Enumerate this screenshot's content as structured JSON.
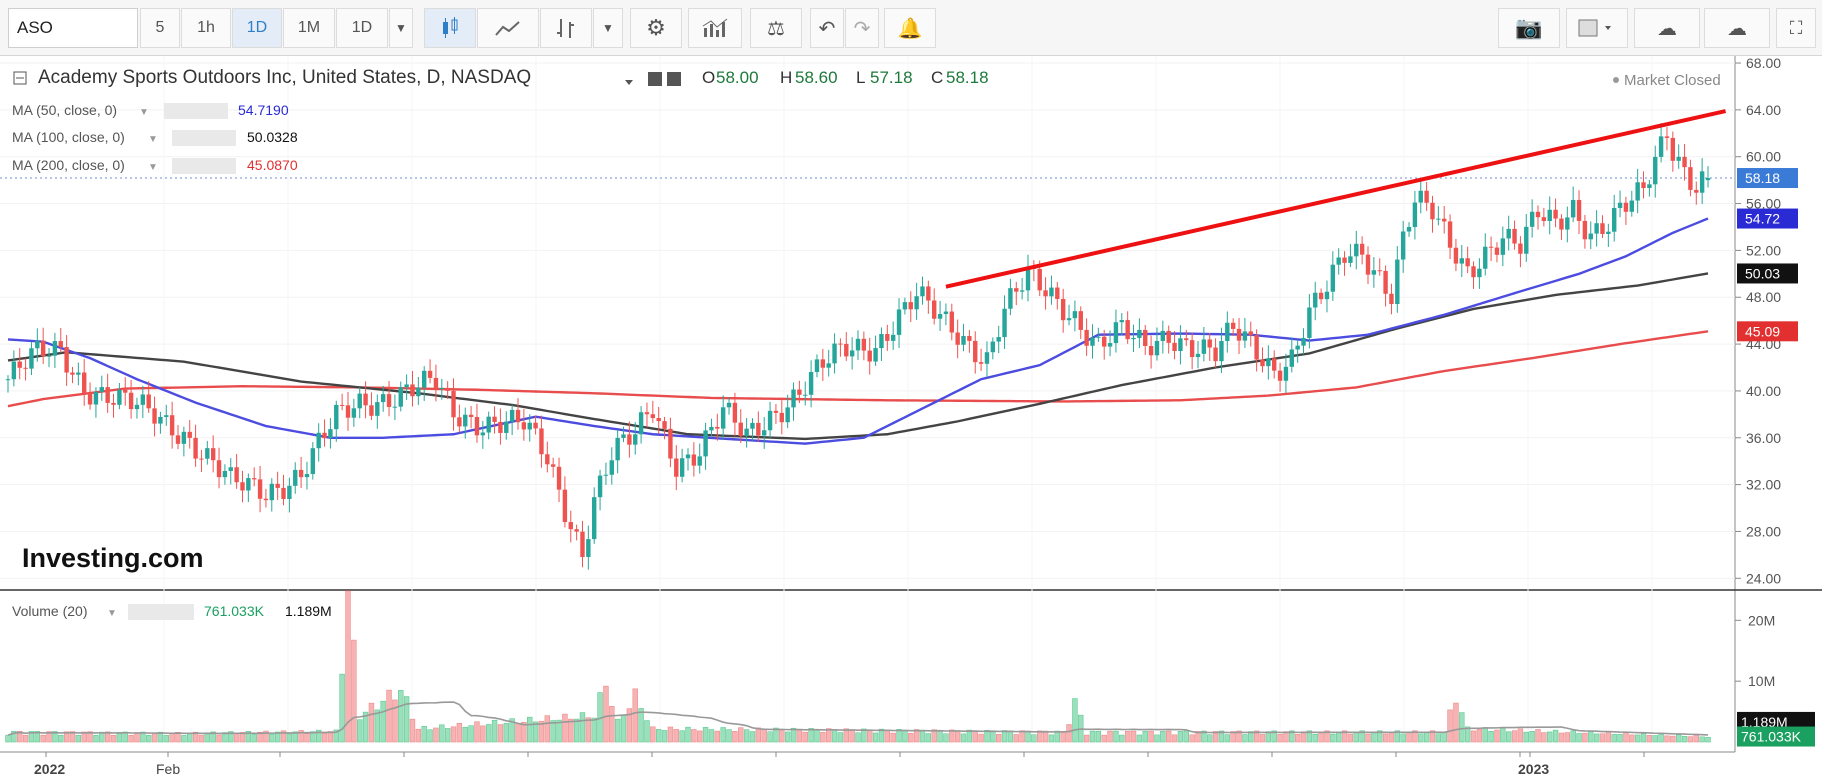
{
  "toolbar": {
    "symbol": "ASO",
    "intervals": [
      "5",
      "1h",
      "1D",
      "1M",
      "1D"
    ],
    "active_interval": "1D"
  },
  "header": {
    "title": "Academy Sports Outdoors Inc, United States, D, NASDAQ",
    "open_label": "O",
    "open": "58.00",
    "high_label": "H",
    "high": "58.60",
    "low_label": "L",
    "low": "57.18",
    "close_label": "C",
    "close": "58.18",
    "status": "Market Closed"
  },
  "indicators": [
    {
      "label": "MA (50, close, 0)",
      "value": "54.7190",
      "color": "#2b2bd6"
    },
    {
      "label": "MA (100, close, 0)",
      "value": "50.0328",
      "color": "#111111"
    },
    {
      "label": "MA (200, close, 0)",
      "value": "45.0870",
      "color": "#e23030"
    }
  ],
  "volume_pane": {
    "label": "Volume (20)",
    "value1": "761.033K",
    "value2": "1.189M"
  },
  "watermark": "Investing.com",
  "colors": {
    "up": "#26a69a",
    "down": "#ef5350",
    "ma50": "#4c4ce0",
    "ma100": "#444444",
    "ma200": "#e84c4c",
    "trend": "#ee1111"
  },
  "chart_data": {
    "type": "candlestick",
    "price_axis": {
      "ticks": [
        "68.00",
        "64.00",
        "60.00",
        "56.00",
        "52.00",
        "48.00",
        "44.00",
        "40.00",
        "36.00",
        "32.00",
        "28.00",
        "24.00"
      ],
      "range": [
        23,
        68.6
      ]
    },
    "volume_axis": {
      "ticks": [
        "20M",
        "10M"
      ],
      "range": [
        0,
        24
      ]
    },
    "x_axis": {
      "labels": [
        "2022",
        "Feb",
        "2023"
      ],
      "ticks": 15
    },
    "price_labels": [
      {
        "text": "58.18",
        "value": 58.18,
        "bg": "#3b7bd8"
      },
      {
        "text": "54.72",
        "value": 54.72,
        "bg": "#2b2bd6"
      },
      {
        "text": "50.03",
        "value": 50.03,
        "bg": "#111111"
      },
      {
        "text": "45.09",
        "value": 45.09,
        "bg": "#e23030"
      }
    ],
    "volume_labels": [
      {
        "text": "1.189M",
        "value": 1.189,
        "bg": "#111111"
      },
      {
        "text": "761.033K",
        "value": 0.761,
        "bg": "#1aa060"
      }
    ],
    "close_keypoints": [
      [
        0,
        41
      ],
      [
        5,
        43
      ],
      [
        9,
        43.5
      ],
      [
        13,
        40.5
      ],
      [
        19,
        39
      ],
      [
        25,
        38
      ],
      [
        30,
        36.5
      ],
      [
        38,
        32
      ],
      [
        44,
        31.5
      ],
      [
        50,
        33
      ],
      [
        56,
        37.5
      ],
      [
        60,
        39
      ],
      [
        64,
        39.5
      ],
      [
        68,
        40
      ],
      [
        73,
        40.5
      ],
      [
        76,
        38
      ],
      [
        80,
        37.5
      ],
      [
        84,
        37.5
      ],
      [
        88,
        37
      ],
      [
        92,
        34
      ],
      [
        95,
        30
      ],
      [
        98,
        26.5
      ],
      [
        100,
        31
      ],
      [
        103,
        34.5
      ],
      [
        107,
        36
      ],
      [
        110,
        38.5
      ],
      [
        114,
        34
      ],
      [
        118,
        35
      ],
      [
        122,
        38
      ],
      [
        126,
        36
      ],
      [
        130,
        38
      ],
      [
        135,
        40
      ],
      [
        139,
        42
      ],
      [
        143,
        43.5
      ],
      [
        148,
        44
      ],
      [
        152,
        46.5
      ],
      [
        155,
        48
      ],
      [
        159,
        46
      ],
      [
        163,
        44.5
      ],
      [
        167,
        43
      ],
      [
        170,
        47
      ],
      [
        174,
        49.5
      ],
      [
        178,
        48
      ],
      [
        182,
        46.5
      ],
      [
        186,
        44
      ],
      [
        190,
        45
      ],
      [
        194,
        43.5
      ],
      [
        198,
        45
      ],
      [
        202,
        44
      ],
      [
        206,
        43
      ],
      [
        209,
        45
      ],
      [
        212,
        44
      ],
      [
        216,
        42
      ],
      [
        219,
        43
      ],
      [
        222,
        46.5
      ],
      [
        225,
        48.5
      ],
      [
        228,
        51.5
      ],
      [
        231,
        52
      ],
      [
        234,
        50
      ],
      [
        236,
        48.5
      ],
      [
        238,
        53
      ],
      [
        240,
        56
      ],
      [
        243,
        55
      ],
      [
        246,
        52.5
      ],
      [
        249,
        50.5
      ],
      [
        252,
        52
      ],
      [
        255,
        53
      ],
      [
        258,
        52
      ],
      [
        261,
        55
      ],
      [
        264,
        54.5
      ],
      [
        267,
        56
      ],
      [
        270,
        53.5
      ],
      [
        273,
        54
      ],
      [
        276,
        55.5
      ],
      [
        279,
        57
      ],
      [
        281,
        60
      ],
      [
        283,
        62.5
      ],
      [
        284,
        61
      ],
      [
        286,
        59
      ],
      [
        288,
        57.5
      ],
      [
        290,
        58.18
      ]
    ],
    "volume_keypoints": [
      [
        0,
        1.5
      ],
      [
        30,
        1.3
      ],
      [
        56,
        1.6
      ],
      [
        58,
        23
      ],
      [
        60,
        4
      ],
      [
        67,
        8
      ],
      [
        70,
        2
      ],
      [
        100,
        4
      ],
      [
        102,
        9
      ],
      [
        104,
        3
      ],
      [
        107,
        7
      ],
      [
        110,
        2
      ],
      [
        180,
        1.5
      ],
      [
        182,
        6
      ],
      [
        184,
        1.5
      ],
      [
        245,
        1.5
      ],
      [
        247,
        7
      ],
      [
        249,
        2
      ],
      [
        290,
        0.8
      ]
    ],
    "ma50_keypoints": [
      [
        0,
        44.4
      ],
      [
        6,
        44.2
      ],
      [
        14,
        42.8
      ],
      [
        22,
        41
      ],
      [
        32,
        39
      ],
      [
        44,
        37
      ],
      [
        55,
        36
      ],
      [
        64,
        36
      ],
      [
        76,
        36.3
      ],
      [
        90,
        37.8
      ],
      [
        100,
        37
      ],
      [
        110,
        36.3
      ],
      [
        126,
        35.8
      ],
      [
        136,
        35.5
      ],
      [
        146,
        36
      ],
      [
        156,
        38.5
      ],
      [
        166,
        41
      ],
      [
        176,
        42.2
      ],
      [
        186,
        44.8
      ],
      [
        200,
        44.9
      ],
      [
        212,
        44.8
      ],
      [
        222,
        44.3
      ],
      [
        232,
        44.8
      ],
      [
        245,
        46.5
      ],
      [
        258,
        48.5
      ],
      [
        268,
        50
      ],
      [
        276,
        51.5
      ],
      [
        284,
        53.5
      ],
      [
        290,
        54.72
      ]
    ],
    "ma100_keypoints": [
      [
        0,
        42.6
      ],
      [
        10,
        43.3
      ],
      [
        30,
        42.5
      ],
      [
        50,
        40.8
      ],
      [
        70,
        39.8
      ],
      [
        86,
        38.8
      ],
      [
        100,
        37.6
      ],
      [
        116,
        36.3
      ],
      [
        136,
        35.9
      ],
      [
        150,
        36.3
      ],
      [
        162,
        37.4
      ],
      [
        176,
        38.9
      ],
      [
        190,
        40.5
      ],
      [
        206,
        42
      ],
      [
        222,
        43.2
      ],
      [
        236,
        45.2
      ],
      [
        250,
        47
      ],
      [
        264,
        48.2
      ],
      [
        278,
        49
      ],
      [
        290,
        50.03
      ]
    ],
    "ma200_keypoints": [
      [
        0,
        38.7
      ],
      [
        6,
        39.3
      ],
      [
        20,
        40.2
      ],
      [
        40,
        40.4
      ],
      [
        60,
        40.3
      ],
      [
        80,
        40.1
      ],
      [
        100,
        39.8
      ],
      [
        120,
        39.4
      ],
      [
        150,
        39.2
      ],
      [
        180,
        39.1
      ],
      [
        200,
        39.2
      ],
      [
        215,
        39.6
      ],
      [
        230,
        40.3
      ],
      [
        245,
        41.7
      ],
      [
        260,
        42.8
      ],
      [
        275,
        44
      ],
      [
        290,
        45.09
      ]
    ],
    "trendline": [
      [
        160,
        48.9
      ],
      [
        293,
        63.9
      ]
    ]
  }
}
